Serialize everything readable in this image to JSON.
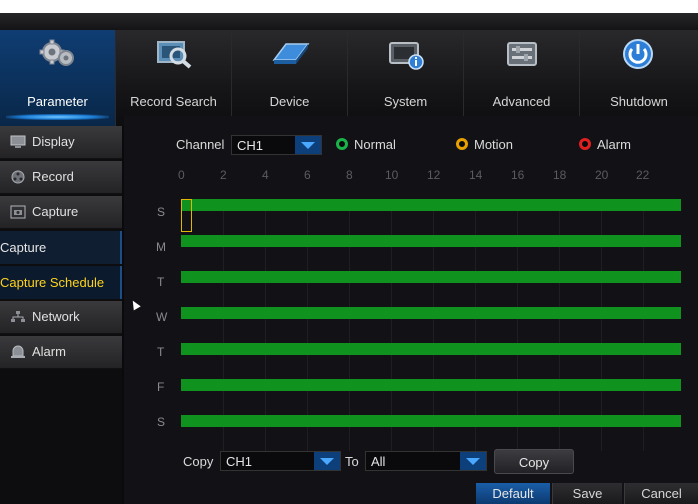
{
  "colors": {
    "accent": "#0f3d73",
    "record_bar": "#10921f",
    "selected_text": "#ffd21a",
    "normal": "#19b34a",
    "motion": "#e8a000",
    "alarm": "#e02020"
  },
  "nav": {
    "tabs": [
      {
        "label": "Parameter",
        "icon": "gears-icon"
      },
      {
        "label": "Record Search",
        "icon": "magnifier-film-icon"
      },
      {
        "label": "Device",
        "icon": "hard-drive-icon"
      },
      {
        "label": "System",
        "icon": "monitor-info-icon"
      },
      {
        "label": "Advanced",
        "icon": "sliders-icon"
      },
      {
        "label": "Shutdown",
        "icon": "power-icon"
      }
    ],
    "active_index": 0
  },
  "sidebar": {
    "items": [
      {
        "label": "Display",
        "icon": "monitor-icon"
      },
      {
        "label": "Record",
        "icon": "reel-icon"
      },
      {
        "label": "Capture",
        "icon": "camera-icon"
      },
      {
        "label": "Capture"
      },
      {
        "label": "Capture Schedule"
      },
      {
        "label": "Network",
        "icon": "network-icon"
      },
      {
        "label": "Alarm",
        "icon": "alarm-icon"
      }
    ]
  },
  "toolbar": {
    "channel_label": "Channel",
    "channel_value": "CH1",
    "legend": [
      {
        "label": "Normal"
      },
      {
        "label": "Motion"
      },
      {
        "label": "Alarm"
      }
    ]
  },
  "schedule": {
    "hours": [
      "0",
      "2",
      "4",
      "6",
      "8",
      "10",
      "12",
      "14",
      "16",
      "18",
      "20",
      "22"
    ],
    "days": [
      "S",
      "M",
      "T",
      "W",
      "T",
      "F",
      "S"
    ],
    "recording": "Normal, all hours, every day"
  },
  "copy": {
    "copy_label": "Copy",
    "copy_value": "CH1",
    "to_label": "To",
    "to_value": "All",
    "copy_button": "Copy"
  },
  "actions": {
    "default": "Default",
    "save": "Save",
    "cancel": "Cancel"
  }
}
